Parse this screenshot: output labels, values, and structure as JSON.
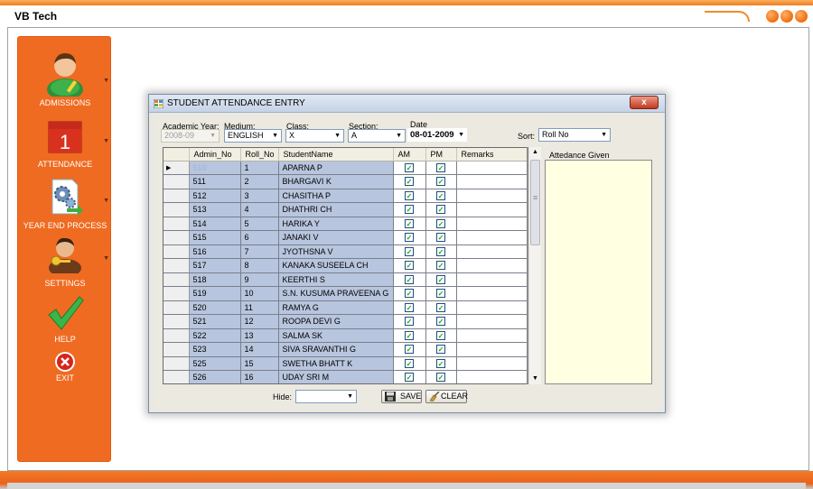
{
  "app": {
    "title": "VB Tech"
  },
  "sidebar": {
    "items": [
      {
        "label": "ADMISSIONS",
        "icon": "student-icon"
      },
      {
        "label": "ATTENDANCE",
        "icon": "calendar-icon",
        "calendar_day": "1"
      },
      {
        "label": "YEAR END PROCESS",
        "icon": "gears-document-icon"
      },
      {
        "label": "SETTINGS",
        "icon": "user-key-icon"
      },
      {
        "label": "HELP",
        "icon": "checkmark-icon"
      },
      {
        "label": "EXIT",
        "icon": "exit-icon"
      }
    ]
  },
  "dialog": {
    "title": "STUDENT ATTENDANCE ENTRY",
    "close_label": "x",
    "filters": {
      "academic_year": {
        "label": "Academic Year:",
        "value": "2008-09"
      },
      "medium": {
        "label": "Medium:",
        "value": "ENGLISH"
      },
      "class": {
        "label": "Class:",
        "value": "X"
      },
      "section": {
        "label": "Section:",
        "value": "A"
      },
      "date": {
        "label": "Date",
        "value": "08-01-2009"
      },
      "sort": {
        "label": "Sort:",
        "value": "Roll No"
      }
    },
    "grid": {
      "columns": [
        "Admin_No",
        "Roll_No",
        "StudentName",
        "AM",
        "PM",
        "Remarks"
      ],
      "current_row_marker": "▶",
      "rows": [
        {
          "admin_no": "510",
          "roll_no": "1",
          "name": "APARNA P"
        },
        {
          "admin_no": "511",
          "roll_no": "2",
          "name": "BHARGAVI K"
        },
        {
          "admin_no": "512",
          "roll_no": "3",
          "name": "CHASITHA P"
        },
        {
          "admin_no": "513",
          "roll_no": "4",
          "name": "DHATHRI CH"
        },
        {
          "admin_no": "514",
          "roll_no": "5",
          "name": "HARIKA Y"
        },
        {
          "admin_no": "515",
          "roll_no": "6",
          "name": "JANAKI V"
        },
        {
          "admin_no": "516",
          "roll_no": "7",
          "name": "JYOTHSNA V"
        },
        {
          "admin_no": "517",
          "roll_no": "8",
          "name": "KANAKA SUSEELA CH"
        },
        {
          "admin_no": "518",
          "roll_no": "9",
          "name": "KEERTHI S"
        },
        {
          "admin_no": "519",
          "roll_no": "10",
          "name": "S.N. KUSUMA PRAVEENA G"
        },
        {
          "admin_no": "520",
          "roll_no": "11",
          "name": "RAMYA G"
        },
        {
          "admin_no": "521",
          "roll_no": "12",
          "name": "ROOPA DEVI G"
        },
        {
          "admin_no": "522",
          "roll_no": "13",
          "name": "SALMA SK"
        },
        {
          "admin_no": "523",
          "roll_no": "14",
          "name": "SIVA SRAVANTHI G"
        },
        {
          "admin_no": "525",
          "roll_no": "15",
          "name": "SWETHA BHATT K"
        },
        {
          "admin_no": "526",
          "roll_no": "16",
          "name": "UDAY SRI M"
        }
      ]
    },
    "attendance_panel": {
      "label": "Attedance Given"
    },
    "hide": {
      "label": "Hide:",
      "value": ""
    },
    "buttons": {
      "save": "SAVE",
      "clear": "CLEAR"
    }
  },
  "colors": {
    "accent_orange": "#ef6b21",
    "grid_selection": "#b8c5de",
    "panel_yellow": "#ffffe1"
  }
}
